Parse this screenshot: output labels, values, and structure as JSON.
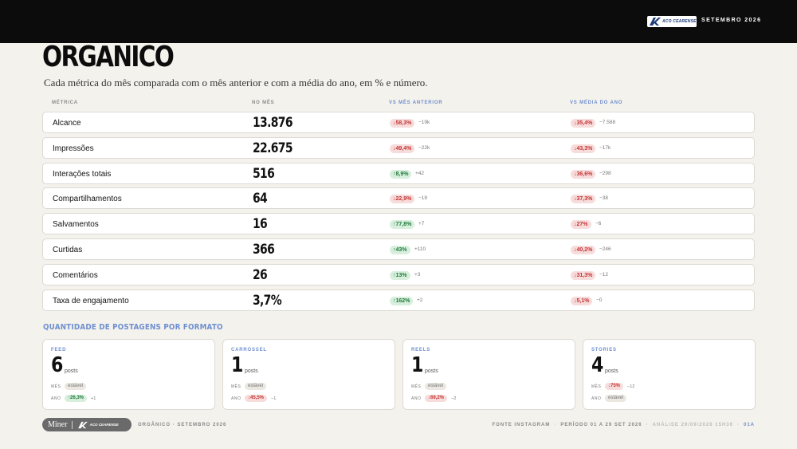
{
  "header": {
    "brand": "ACO CEARENSE",
    "date": "SETEMBRO 2026"
  },
  "page": {
    "title": "ORGANICO",
    "subtitle": "Cada métrica do mês comparada com o mês anterior e com a média do ano, em % e número."
  },
  "table": {
    "headers": {
      "metric": "MÉTRICA",
      "month": "NO MÊS",
      "prev": "VS MÊS ANTERIOR",
      "avg": "VS MÉDIA DO ANO"
    },
    "rows": [
      {
        "label": "Alcance",
        "value": "13.876",
        "prev_pct": "↓58,3%",
        "prev_dir": "down",
        "prev_delta": "−19k",
        "avg_pct": "↓35,4%",
        "avg_dir": "down",
        "avg_delta": "−7.588"
      },
      {
        "label": "Impressões",
        "value": "22.675",
        "prev_pct": "↓49,4%",
        "prev_dir": "down",
        "prev_delta": "−22k",
        "avg_pct": "↓43,3%",
        "avg_dir": "down",
        "avg_delta": "−17k"
      },
      {
        "label": "Interações totais",
        "value": "516",
        "prev_pct": "↑8,9%",
        "prev_dir": "up",
        "prev_delta": "+42",
        "avg_pct": "↓36,6%",
        "avg_dir": "down",
        "avg_delta": "−298"
      },
      {
        "label": "Compartilhamentos",
        "value": "64",
        "prev_pct": "↓22,9%",
        "prev_dir": "down",
        "prev_delta": "−19",
        "avg_pct": "↓37,3%",
        "avg_dir": "down",
        "avg_delta": "−38"
      },
      {
        "label": "Salvamentos",
        "value": "16",
        "prev_pct": "↑77,8%",
        "prev_dir": "up",
        "prev_delta": "+7",
        "avg_pct": "↓27%",
        "avg_dir": "down",
        "avg_delta": "−6"
      },
      {
        "label": "Curtidas",
        "value": "366",
        "prev_pct": "↑43%",
        "prev_dir": "up",
        "prev_delta": "+110",
        "avg_pct": "↓40,2%",
        "avg_dir": "down",
        "avg_delta": "−246"
      },
      {
        "label": "Comentários",
        "value": "26",
        "prev_pct": "↑13%",
        "prev_dir": "up",
        "prev_delta": "+3",
        "avg_pct": "↓31,3%",
        "avg_dir": "down",
        "avg_delta": "−12"
      },
      {
        "label": "Taxa de engajamento",
        "value": "3,7%",
        "prev_pct": "↑162%",
        "prev_dir": "up",
        "prev_delta": "+2",
        "avg_pct": "↓5,1%",
        "avg_dir": "down",
        "avg_delta": "−0"
      }
    ]
  },
  "formats": {
    "title": "QUANTIDADE DE POSTAGENS POR FORMATO",
    "posts_label": "posts",
    "month_label": "MÊS",
    "year_label": "ANO",
    "cards": [
      {
        "name": "FEED",
        "count": "6",
        "month_pill": "estável",
        "month_dir": "stable",
        "month_delta": "",
        "year_pill": "↑26,3%",
        "year_dir": "up",
        "year_delta": "+1"
      },
      {
        "name": "CARROSSEL",
        "count": "1",
        "month_pill": "estável",
        "month_dir": "stable",
        "month_delta": "",
        "year_pill": "↓45,5%",
        "year_dir": "down",
        "year_delta": "−1"
      },
      {
        "name": "REELS",
        "count": "1",
        "month_pill": "estável",
        "month_dir": "stable",
        "month_delta": "",
        "year_pill": "↓69,2%",
        "year_dir": "down",
        "year_delta": "−2"
      },
      {
        "name": "STORIES",
        "count": "4",
        "month_pill": "↓75%",
        "month_dir": "down",
        "month_delta": "−12",
        "year_pill": "estável",
        "year_dir": "stable",
        "year_delta": ""
      }
    ]
  },
  "footer": {
    "miner": "Miner",
    "brand": "ACO CEARENSE",
    "left": "ORGÂNICO · SETEMBRO 2026",
    "source": "FONTE INSTAGRAM",
    "period": "PERÍODO 01 A 29 SET 2026",
    "analysis": "ANÁLISE 29/09/2026 15H30",
    "code": "01A"
  }
}
